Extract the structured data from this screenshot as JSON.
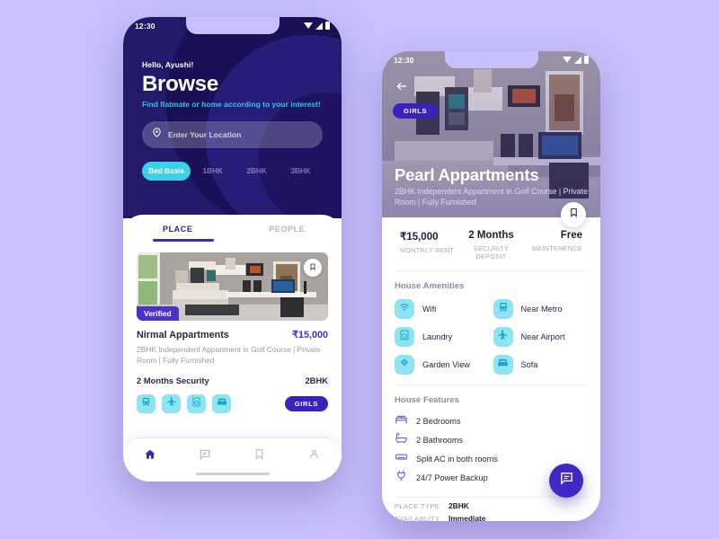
{
  "background_color": "#c7c0fc",
  "accent": {
    "purple": "#4327c4",
    "deep_navy": "#231a6b",
    "cyan": "#3ed0e8",
    "icon_tile": "#8ee4f2"
  },
  "browse_screen": {
    "status_bar": {
      "time": "12:30",
      "icons": [
        "wifi-icon",
        "signal-icon",
        "battery-icon"
      ]
    },
    "greeting": "Hello, Ayushi!",
    "title": "Browse",
    "subtitle": "Find flatmate or home according to your interest!",
    "search": {
      "placeholder": "Enter Your Location",
      "value": "",
      "icon": "location-pin-icon"
    },
    "filter_chips": [
      {
        "label": "Bed Basis",
        "active": true
      },
      {
        "label": "1BHK",
        "active": false
      },
      {
        "label": "2BHK",
        "active": false
      },
      {
        "label": "3BHK",
        "active": false
      }
    ],
    "tabs": [
      {
        "label": "PLACE",
        "active": true
      },
      {
        "label": "PEOPLE",
        "active": false
      }
    ],
    "listing": {
      "image_badge": "Verified",
      "bookmark_icon": "bookmark-icon",
      "name": "Nirmal Appartments",
      "price": "₹15,000",
      "description": "2BHK Independent Appartment in Golf Course | Private Room | Fully Furnished",
      "security": "2 Months Security",
      "bhk": "2BHK",
      "amenity_icons": [
        "metro-icon",
        "airplane-icon",
        "laundry-icon",
        "sofa-icon"
      ],
      "gender_badge": "GIRLS"
    },
    "bottom_nav": [
      {
        "icon": "home-icon",
        "active": true
      },
      {
        "icon": "chat-icon",
        "active": false
      },
      {
        "icon": "bookmark-icon",
        "active": false
      },
      {
        "icon": "profile-icon",
        "active": false
      }
    ]
  },
  "detail_screen": {
    "status_bar": {
      "time": "12:30",
      "icons": [
        "wifi-icon",
        "signal-icon",
        "battery-icon"
      ]
    },
    "back_icon": "arrow-left-icon",
    "gender_badge": "GIRLS",
    "title": "Pearl Appartments",
    "subtitle": "2BHK Independent Appartment in Golf Course | Private Room | Fully Furnished",
    "bookmark_icon": "bookmark-icon",
    "stats": [
      {
        "value": "₹15,000",
        "label": "MONTHLY RENT"
      },
      {
        "value": "2 Months",
        "label": "SECURITY DEPOSIT"
      },
      {
        "value": "Free",
        "label": "MAINTENENCE"
      }
    ],
    "amenities_title": "House Amenities",
    "amenities": [
      {
        "label": "Wifi",
        "icon": "wifi-icon"
      },
      {
        "label": "Near Metro",
        "icon": "metro-icon"
      },
      {
        "label": "Laundry",
        "icon": "laundry-icon"
      },
      {
        "label": "Near Airport",
        "icon": "airplane-icon"
      },
      {
        "label": "Garden View",
        "icon": "plant-icon"
      },
      {
        "label": "Sofa",
        "icon": "sofa-icon"
      }
    ],
    "features_title": "House Features",
    "features": [
      {
        "label": "2 Bedrooms",
        "icon": "bed-icon"
      },
      {
        "label": "2 Bathrooms",
        "icon": "bathtub-icon"
      },
      {
        "label": "Split AC in both rooms",
        "icon": "ac-icon"
      },
      {
        "label": "24/7 Power Backup",
        "icon": "power-plug-icon"
      }
    ],
    "meta": [
      {
        "key": "PLACE TYPE",
        "value": "2BHK"
      },
      {
        "key": "AVAILABLITY",
        "value": "Immediate"
      }
    ],
    "fab_icon": "chat-icon"
  }
}
